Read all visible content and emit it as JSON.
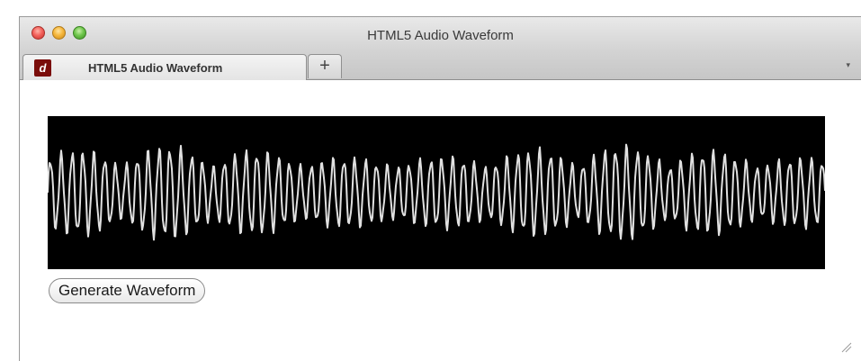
{
  "window": {
    "title": "HTML5 Audio Waveform"
  },
  "tab": {
    "label": "HTML5 Audio Waveform",
    "favicon_letter": "d"
  },
  "new_tab_label": "+",
  "tab_overflow_glyph": "▾",
  "button": {
    "label": "Generate Waveform"
  },
  "colors": {
    "canvas_bg": "#000000",
    "waveform": "#e0e0e0",
    "close": "#f3625c",
    "minimize": "#f6b73c",
    "zoom": "#6ec64b"
  },
  "icons": [
    "close-icon",
    "minimize-icon",
    "zoom-icon",
    "favicon-icon",
    "plus-icon",
    "chevron-down-icon",
    "resize-grip-icon"
  ]
}
